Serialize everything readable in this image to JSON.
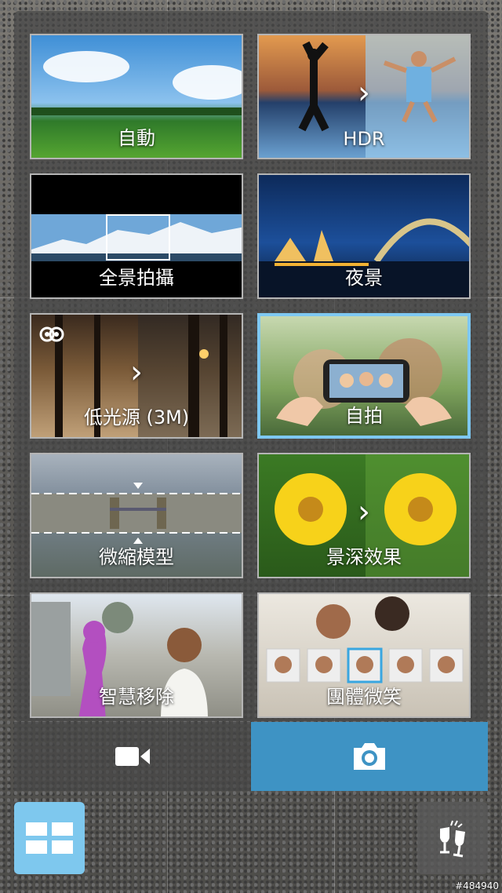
{
  "modes": [
    {
      "label": "自動",
      "icon": "landscape"
    },
    {
      "label": "HDR",
      "icon": "hdr-comparison"
    },
    {
      "label": "全景拍攝",
      "icon": "panorama-mountains"
    },
    {
      "label": "夜景",
      "icon": "night-bridge"
    },
    {
      "label": "低光源 (3M)",
      "icon": "low-light-forest"
    },
    {
      "label": "自拍",
      "icon": "selfie-phone"
    },
    {
      "label": "微縮模型",
      "icon": "miniature-city"
    },
    {
      "label": "景深效果",
      "icon": "depth-flower"
    },
    {
      "label": "智慧移除",
      "icon": "smart-remove"
    },
    {
      "label": "團體微笑",
      "icon": "group-smile"
    }
  ],
  "selected_mode": "自拍",
  "bottom": {
    "video_icon": "video-camera-icon",
    "photo_icon": "camera-icon",
    "grid_icon": "grid-icon",
    "party_icon": "cheers-icon"
  },
  "watermark": "#484940",
  "colors": {
    "accent": "#3e93c4",
    "highlight": "#7ec8f2"
  }
}
